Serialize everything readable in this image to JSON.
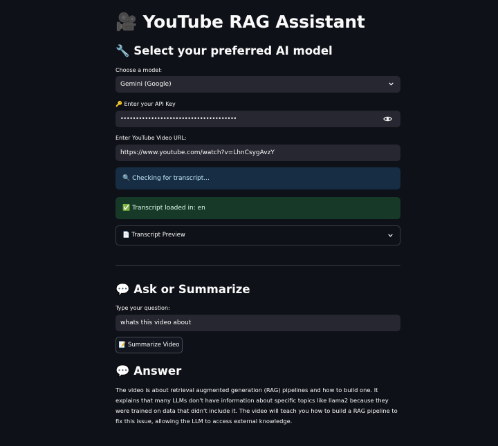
{
  "app": {
    "title_icon": "🎥",
    "title": "YouTube RAG Assistant"
  },
  "model_section": {
    "heading_icon": "🔧",
    "heading": "Select your preferred AI model",
    "choose_label": "Choose a model:",
    "selected_model": "Gemini (Google)",
    "api_key_label": "🔑 Enter your API Key",
    "api_key_masked": "••••••••••••••••••••••••••••••••••••••",
    "url_label": "Enter YouTube Video URL:",
    "url_value": "https://www.youtube.com/watch?v=LhnCsygAvzY"
  },
  "status": {
    "info_text": "🔍 Checking for transcript...",
    "success_text": "✅ Transcript loaded in: en",
    "expander_label": "📄 Transcript Preview"
  },
  "ask_section": {
    "heading_icon": "💬",
    "heading": "Ask or Summarize",
    "question_label": "Type your question:",
    "question_value": "whats this video about",
    "summarize_button": "📝 Summarize Video"
  },
  "answer_section": {
    "heading_icon": "💬",
    "heading": "Answer",
    "text": "The video is about retrieval augmented generation (RAG) pipelines and how to build one. It explains that many LLMs don't have information about specific topics like llama2 because they were trained on data that didn't include it. The video will teach you how to build a RAG pipeline to fix this issue, allowing the LLM to access external knowledge."
  },
  "colors": {
    "background": "#0e1117",
    "field": "#262730",
    "info": "#172d43",
    "success": "#173928"
  }
}
